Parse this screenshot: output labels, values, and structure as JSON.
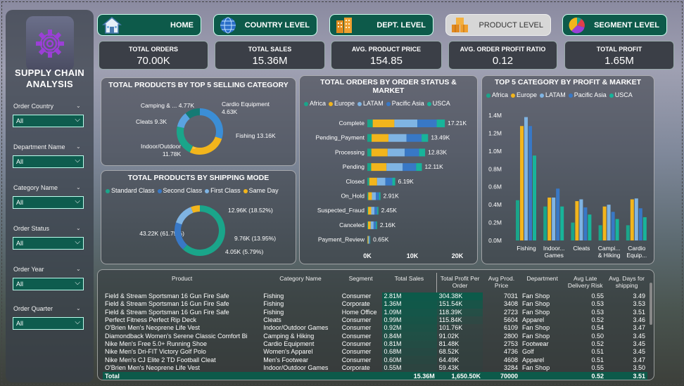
{
  "app": {
    "title": "SUPPLY CHAIN ANALYSIS"
  },
  "filters": [
    {
      "label": "Order Country",
      "value": "All"
    },
    {
      "label": "Department Name",
      "value": "All"
    },
    {
      "label": "Category Name",
      "value": "All"
    },
    {
      "label": "Order Status",
      "value": "All"
    },
    {
      "label": "Order Year",
      "value": "All"
    },
    {
      "label": "Order Quarter",
      "value": "All"
    }
  ],
  "nav": [
    {
      "label": "HOME",
      "icon": "home-icon"
    },
    {
      "label": "COUNTRY LEVEL",
      "icon": "globe-icon"
    },
    {
      "label": "DEPT. LEVEL",
      "icon": "building-icon"
    },
    {
      "label": "PRODUCT LEVEL",
      "icon": "boxes-icon",
      "active": true
    },
    {
      "label": "SEGMENT LEVEL",
      "icon": "pie-icon"
    }
  ],
  "kpis": [
    {
      "label": "TOTAL ORDERS",
      "value": "70.00K"
    },
    {
      "label": "TOTAL SALES",
      "value": "15.36M"
    },
    {
      "label": "AVG. PRODUCT PRICE",
      "value": "154.85"
    },
    {
      "label": "AVG. ORDER PROFIT RATIO",
      "value": "0.12"
    },
    {
      "label": "TOTAL PROFIT",
      "value": "1.65M"
    }
  ],
  "colors": {
    "Africa": "#1aa58a",
    "Europe": "#f2b51c",
    "LATAM": "#7fb4e3",
    "Pacific Asia": "#3878c6",
    "USCA": "#18b49a",
    "accent": "#0d5a4a"
  },
  "chart_data": [
    {
      "type": "pie",
      "title": "TOTAL PRODUCTS BY TOP 5 SELLING CATEGORY",
      "slices": [
        {
          "label": "Fishing",
          "value": 13.16,
          "display": "Fishing 13.16K",
          "color": "#3b8ed6"
        },
        {
          "label": "Indoor/Outdoor Ga...",
          "value": 11.78,
          "display": "11.78K",
          "color": "#f2b51c"
        },
        {
          "label": "Cleats",
          "value": 9.3,
          "display": "Cleats 9.3K",
          "color": "#1aa58a"
        },
        {
          "label": "Camping & ...",
          "value": 4.77,
          "display": "Camping & ... 4.77K",
          "color": "#5aa3e0"
        },
        {
          "label": "Cardio Equipment",
          "value": 4.63,
          "display": "Cardio Equipment 4.63K",
          "color": "#147a74"
        }
      ]
    },
    {
      "type": "pie",
      "title": "TOTAL PRODUCTS BY SHIPPING MODE",
      "legend": [
        "Standard Class",
        "Second Class",
        "First Class",
        "Same Day"
      ],
      "legend_colors": [
        "#1aa58a",
        "#3878c6",
        "#7fb4e3",
        "#f2b51c"
      ],
      "slices": [
        {
          "label": "Standard Class",
          "value": 43.22,
          "display": "43.22K (61.75%)",
          "color": "#1aa58a"
        },
        {
          "label": "Second Class",
          "value": 12.96,
          "display": "12.96K (18.52%)",
          "color": "#3878c6"
        },
        {
          "label": "First Class",
          "value": 9.76,
          "display": "9.76K (13.95%)",
          "color": "#7fb4e3"
        },
        {
          "label": "Same Day",
          "value": 4.05,
          "display": "4.05K (5.79%)",
          "color": "#f2b51c"
        }
      ]
    },
    {
      "type": "bar",
      "orientation": "horizontal-stacked",
      "title": "TOTAL ORDERS BY ORDER STATUS & MARKET",
      "series_names": [
        "Africa",
        "Europe",
        "LATAM",
        "Pacific Asia",
        "USCA"
      ],
      "categories": [
        "Complete",
        "Pending_Payment",
        "Processing",
        "Pending",
        "Closed",
        "On_Hold",
        "Suspected_Fraud",
        "Canceled",
        "Payment_Review"
      ],
      "totals": [
        "17.21K",
        "13.49K",
        "12.83K",
        "12.11K",
        "6.19K",
        "2.91K",
        "2.45K",
        "2.16K",
        "0.65K"
      ],
      "values": [
        [
          1.2,
          4.8,
          5.1,
          4.3,
          1.81
        ],
        [
          0.95,
          3.75,
          4.0,
          3.35,
          1.44
        ],
        [
          0.9,
          3.6,
          3.8,
          3.2,
          1.33
        ],
        [
          0.85,
          3.4,
          3.6,
          3.0,
          1.26
        ],
        [
          0.43,
          1.73,
          1.84,
          1.55,
          0.64
        ],
        [
          0.2,
          0.81,
          0.87,
          0.73,
          0.3
        ],
        [
          0.17,
          0.69,
          0.73,
          0.61,
          0.25
        ],
        [
          0.15,
          0.6,
          0.64,
          0.54,
          0.23
        ],
        [
          0.05,
          0.18,
          0.19,
          0.16,
          0.07
        ]
      ],
      "xticks": [
        "0K",
        "10K",
        "20K"
      ],
      "xlim": [
        0,
        20
      ]
    },
    {
      "type": "bar",
      "title": "TOP 5 CATEGORY BY PROFIT & MARKET",
      "series_names": [
        "Africa",
        "Europe",
        "LATAM",
        "Pacific Asia",
        "USCA"
      ],
      "categories": [
        "Fishing",
        "Indoor... Games",
        "Cleats",
        "Campi... & Hiking",
        "Cardio Equip..."
      ],
      "values": [
        [
          0.45,
          1.28,
          1.38,
          1.28,
          0.95
        ],
        [
          0.38,
          0.48,
          0.48,
          0.58,
          0.38
        ],
        [
          0.2,
          0.44,
          0.46,
          0.37,
          0.29
        ],
        [
          0.17,
          0.38,
          0.4,
          0.32,
          0.24
        ],
        [
          0.17,
          0.46,
          0.47,
          0.36,
          0.26
        ]
      ],
      "yticks": [
        "0.0M",
        "0.2M",
        "0.4M",
        "0.6M",
        "0.8M",
        "1.0M",
        "1.2M",
        "1.4M"
      ],
      "ylim": [
        0,
        1.4
      ]
    }
  ],
  "table": {
    "columns": [
      "Product",
      "Category Name",
      "Segment",
      "Total Sales",
      "Total Profit Per Order",
      "Avg Prod. Price",
      "Department",
      "Avg Late Delivery Risk",
      "Avg. Days for shipping"
    ],
    "rows": [
      [
        "Field & Stream Sportsman 16 Gun Fire Safe",
        "Fishing",
        "Consumer",
        "2.81M",
        "304.38K",
        "7031",
        "Fan Shop",
        "0.55",
        "3.49"
      ],
      [
        "Field & Stream Sportsman 16 Gun Fire Safe",
        "Fishing",
        "Corporate",
        "1.36M",
        "151.54K",
        "3408",
        "Fan Shop",
        "0.53",
        "3.53"
      ],
      [
        "Field & Stream Sportsman 16 Gun Fire Safe",
        "Fishing",
        "Home Office",
        "1.09M",
        "118.39K",
        "2723",
        "Fan Shop",
        "0.53",
        "3.51"
      ],
      [
        "Perfect Fitness Perfect Rip Deck",
        "Cleats",
        "Consumer",
        "0.99M",
        "115.84K",
        "5604",
        "Apparel",
        "0.52",
        "3.46"
      ],
      [
        "O'Brien Men's Neoprene Life Vest",
        "Indoor/Outdoor Games",
        "Consumer",
        "0.92M",
        "101.76K",
        "6109",
        "Fan Shop",
        "0.54",
        "3.47"
      ],
      [
        "Diamondback Women's Serene Classic Comfort Bi",
        "Camping & Hiking",
        "Consumer",
        "0.84M",
        "91.02K",
        "2800",
        "Fan Shop",
        "0.50",
        "3.45"
      ],
      [
        "Nike Men's Free 5.0+ Running Shoe",
        "Cardio Equipment",
        "Consumer",
        "0.81M",
        "81.48K",
        "2753",
        "Footwear",
        "0.52",
        "3.45"
      ],
      [
        "Nike Men's Dri-FIT Victory Golf Polo",
        "Women's Apparel",
        "Consumer",
        "0.68M",
        "68.52K",
        "4736",
        "Golf",
        "0.51",
        "3.45"
      ],
      [
        "Nike Men's CJ Elite 2 TD Football Cleat",
        "Men's Footwear",
        "Consumer",
        "0.60M",
        "64.49K",
        "4608",
        "Apparel",
        "0.51",
        "3.47"
      ],
      [
        "O'Brien Men's Neoprene Life Vest",
        "Indoor/Outdoor Games",
        "Corporate",
        "0.55M",
        "59.43K",
        "3284",
        "Fan Shop",
        "0.55",
        "3.50"
      ]
    ],
    "total": [
      "Total",
      "",
      "",
      "15.36M",
      "1,650.50K",
      "70000",
      "",
      "0.52",
      "3.51"
    ]
  }
}
